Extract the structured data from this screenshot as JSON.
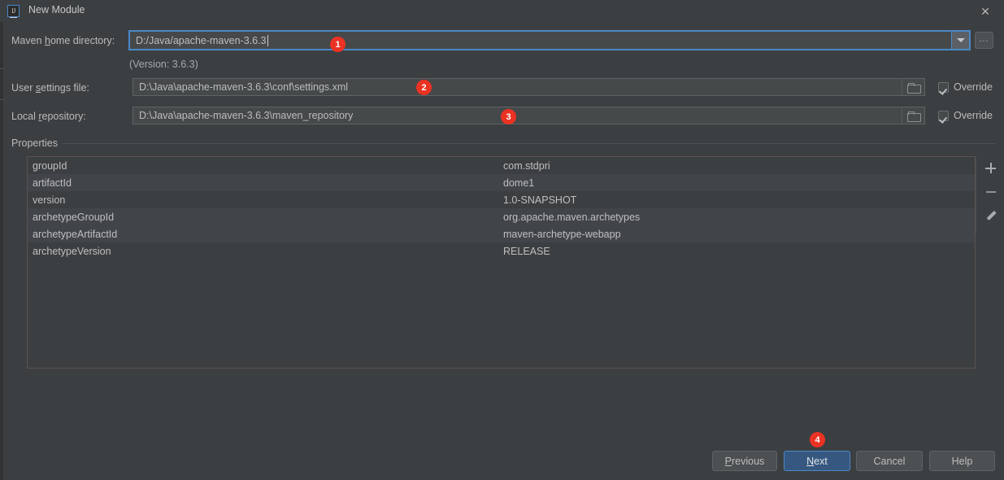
{
  "window": {
    "title": "New Module",
    "app_icon": "intellij-idea-icon",
    "close_icon": "close-icon"
  },
  "form": {
    "maven_home": {
      "label_pre": "Maven ",
      "label_mnemonic": "h",
      "label_post": "ome directory:",
      "value": "D:/Java/apache-maven-3.6.3",
      "dropdown_icon": "chevron-down-icon",
      "browse_label": "...",
      "version_note": "(Version: 3.6.3)"
    },
    "user_settings": {
      "label_pre": "User ",
      "label_mnemonic": "s",
      "label_post": "ettings file:",
      "value": "D:\\Java\\apache-maven-3.6.3\\conf\\settings.xml",
      "folder_icon": "folder-icon",
      "override_label": "Override",
      "override_checked": true
    },
    "local_repository": {
      "label_pre": "Local ",
      "label_mnemonic": "r",
      "label_post": "epository:",
      "value": "D:\\Java\\apache-maven-3.6.3\\maven_repository",
      "folder_icon": "folder-icon",
      "override_label": "Override",
      "override_checked": true
    }
  },
  "properties": {
    "group_label": "Properties",
    "rows": [
      {
        "key": "groupId",
        "value": "com.stdpri"
      },
      {
        "key": "artifactId",
        "value": "dome1"
      },
      {
        "key": "version",
        "value": "1.0-SNAPSHOT"
      },
      {
        "key": "archetypeGroupId",
        "value": "org.apache.maven.archetypes"
      },
      {
        "key": "archetypeArtifactId",
        "value": "maven-archetype-webapp"
      },
      {
        "key": "archetypeVersion",
        "value": "RELEASE"
      }
    ],
    "toolbar": {
      "add_icon": "plus-icon",
      "remove_icon": "minus-icon",
      "edit_icon": "pencil-icon"
    }
  },
  "footer": {
    "previous": {
      "pre": "",
      "mnemonic": "P",
      "post": "revious"
    },
    "next": {
      "pre": "",
      "mnemonic": "N",
      "post": "ext"
    },
    "cancel": {
      "label": "Cancel"
    },
    "help": {
      "label": "Help"
    }
  },
  "annotations": [
    {
      "number": "1"
    },
    {
      "number": "2"
    },
    {
      "number": "3"
    },
    {
      "number": "4"
    }
  ],
  "colors": {
    "window_bg": "#3c3f41",
    "field_bg": "#45494a",
    "focus_border": "#4a88c7",
    "default_button_bg": "#365880",
    "badge_red": "#eb3223",
    "row_alt": "#41454a"
  }
}
